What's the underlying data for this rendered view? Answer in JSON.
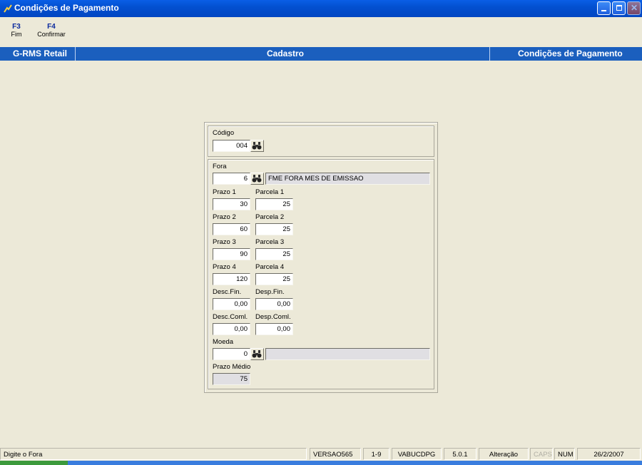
{
  "window": {
    "title": "Condições de Pagamento"
  },
  "toolbar": [
    {
      "key": "F3",
      "label": "Fim"
    },
    {
      "key": "F4",
      "label": "Confirmar"
    }
  ],
  "header": {
    "app": "G-RMS Retail",
    "module": "Cadastro",
    "screen": "Condições de Pagamento"
  },
  "form": {
    "codigo": {
      "label": "Código",
      "value": "004"
    },
    "fora": {
      "label": "Fora",
      "value": "6",
      "description": "FME  FORA MES DE EMISSAO"
    },
    "prazo1": {
      "label": "Prazo 1",
      "value": "30"
    },
    "parcela1": {
      "label": "Parcela 1",
      "value": "25"
    },
    "prazo2": {
      "label": "Prazo 2",
      "value": "60"
    },
    "parcela2": {
      "label": "Parcela 2",
      "value": "25"
    },
    "prazo3": {
      "label": "Prazo 3",
      "value": "90"
    },
    "parcela3": {
      "label": "Parcela 3",
      "value": "25"
    },
    "prazo4": {
      "label": "Prazo 4",
      "value": "120"
    },
    "parcela4": {
      "label": "Parcela 4",
      "value": "25"
    },
    "descfin": {
      "label": "Desc.Fin.",
      "value": "0,00"
    },
    "despfin": {
      "label": "Desp.Fin.",
      "value": "0,00"
    },
    "desccoml": {
      "label": "Desc.Coml.",
      "value": "0,00"
    },
    "despcoml": {
      "label": "Desp.Coml.",
      "value": "0,00"
    },
    "moeda": {
      "label": "Moeda",
      "value": "0",
      "description": ""
    },
    "prazo_medio": {
      "label": "Prazo Médio",
      "value": "75"
    }
  },
  "status": {
    "message": "Digite o Fora",
    "version": "VERSAO565",
    "range": "1-9",
    "program": "VABUCDPG",
    "build": "5.0.1",
    "mode": "Alteração",
    "caps": "CAPS",
    "num": "NUM",
    "date": "26/2/2007"
  },
  "icons": {
    "app": "app-icon",
    "search": "binoculars-icon"
  }
}
